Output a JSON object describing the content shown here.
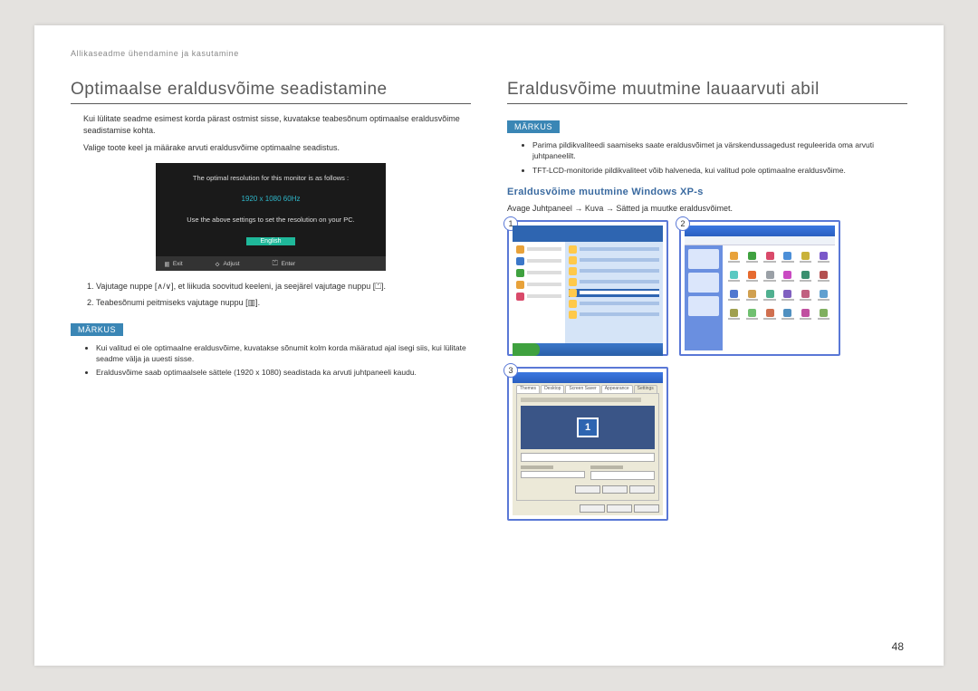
{
  "header": "Allikaseadme ühendamine ja kasutamine",
  "page_number": "48",
  "left": {
    "title": "Optimaalse eraldusvõime seadistamine",
    "p1": "Kui lülitate seadme esimest korda pärast ostmist sisse, kuvatakse teabesõnum optimaalse eraldusvõime seadistamise kohta.",
    "p2": "Valige toote keel ja määrake arvuti eraldusvõime optimaalne seadistus.",
    "osd": {
      "line1": "The optimal resolution for this monitor is as follows :",
      "resolution": "1920 x 1080  60Hz",
      "line2": "Use the above settings to set the resolution on your PC.",
      "language": "English",
      "exit": "Exit",
      "adjust": "Adjust",
      "enter": "Enter"
    },
    "steps": [
      "Vajutage nuppe [∧/∨], et liikuda soovitud keeleni, ja seejärel vajutage nuppu [⏍].",
      "Teabesõnumi peitmiseks vajutage nuppu [▥]."
    ],
    "note_label": "MÄRKUS",
    "notes": [
      "Kui valitud ei ole optimaalne eraldusvõime, kuvatakse sõnumit kolm korda määratud ajal isegi siis, kui lülitate seadme välja ja uuesti sisse.",
      "Eraldusvõime saab optimaalsele sättele (1920 x 1080) seadistada ka arvuti juhtpaneeli kaudu."
    ]
  },
  "right": {
    "title": "Eraldusvõime muutmine lauaarvuti abil",
    "note_label": "MÄRKUS",
    "notes": [
      "Parima pildikvaliteedi saamiseks saate eraldusvõimet ja värskendussagedust reguleerida oma arvuti juhtpaneelilt.",
      "TFT-LCD-monitoride pildikvaliteet võib halveneda, kui valitud pole optimaalne eraldusvõime."
    ],
    "sub": "Eraldusvõime muutmine Windows XP-s",
    "sub_p": "Avage Juhtpaneel → Kuva → Sätted ja muutke eraldusvõimet.",
    "shots": {
      "n1": "1",
      "n2": "2",
      "n3": "3",
      "s3_tabs": [
        "Themes",
        "Desktop",
        "Screen Saver",
        "Appearance",
        "Settings"
      ],
      "s3_monitor_num": "1"
    }
  },
  "cp_icon_colors": [
    "#e8a23a",
    "#3fa13f",
    "#d94a6a",
    "#4c8fd8",
    "#c9b23a",
    "#7a58c9",
    "#5ac9c2",
    "#e66a2f",
    "#9aa0a6",
    "#c94ac2",
    "#3a8f6f",
    "#b35050",
    "#5078d0",
    "#d0a050",
    "#50b090",
    "#8060c0",
    "#c06080",
    "#60a0d0",
    "#a0a050",
    "#70c070",
    "#d07050",
    "#5090c0",
    "#c050a0",
    "#80b060"
  ]
}
